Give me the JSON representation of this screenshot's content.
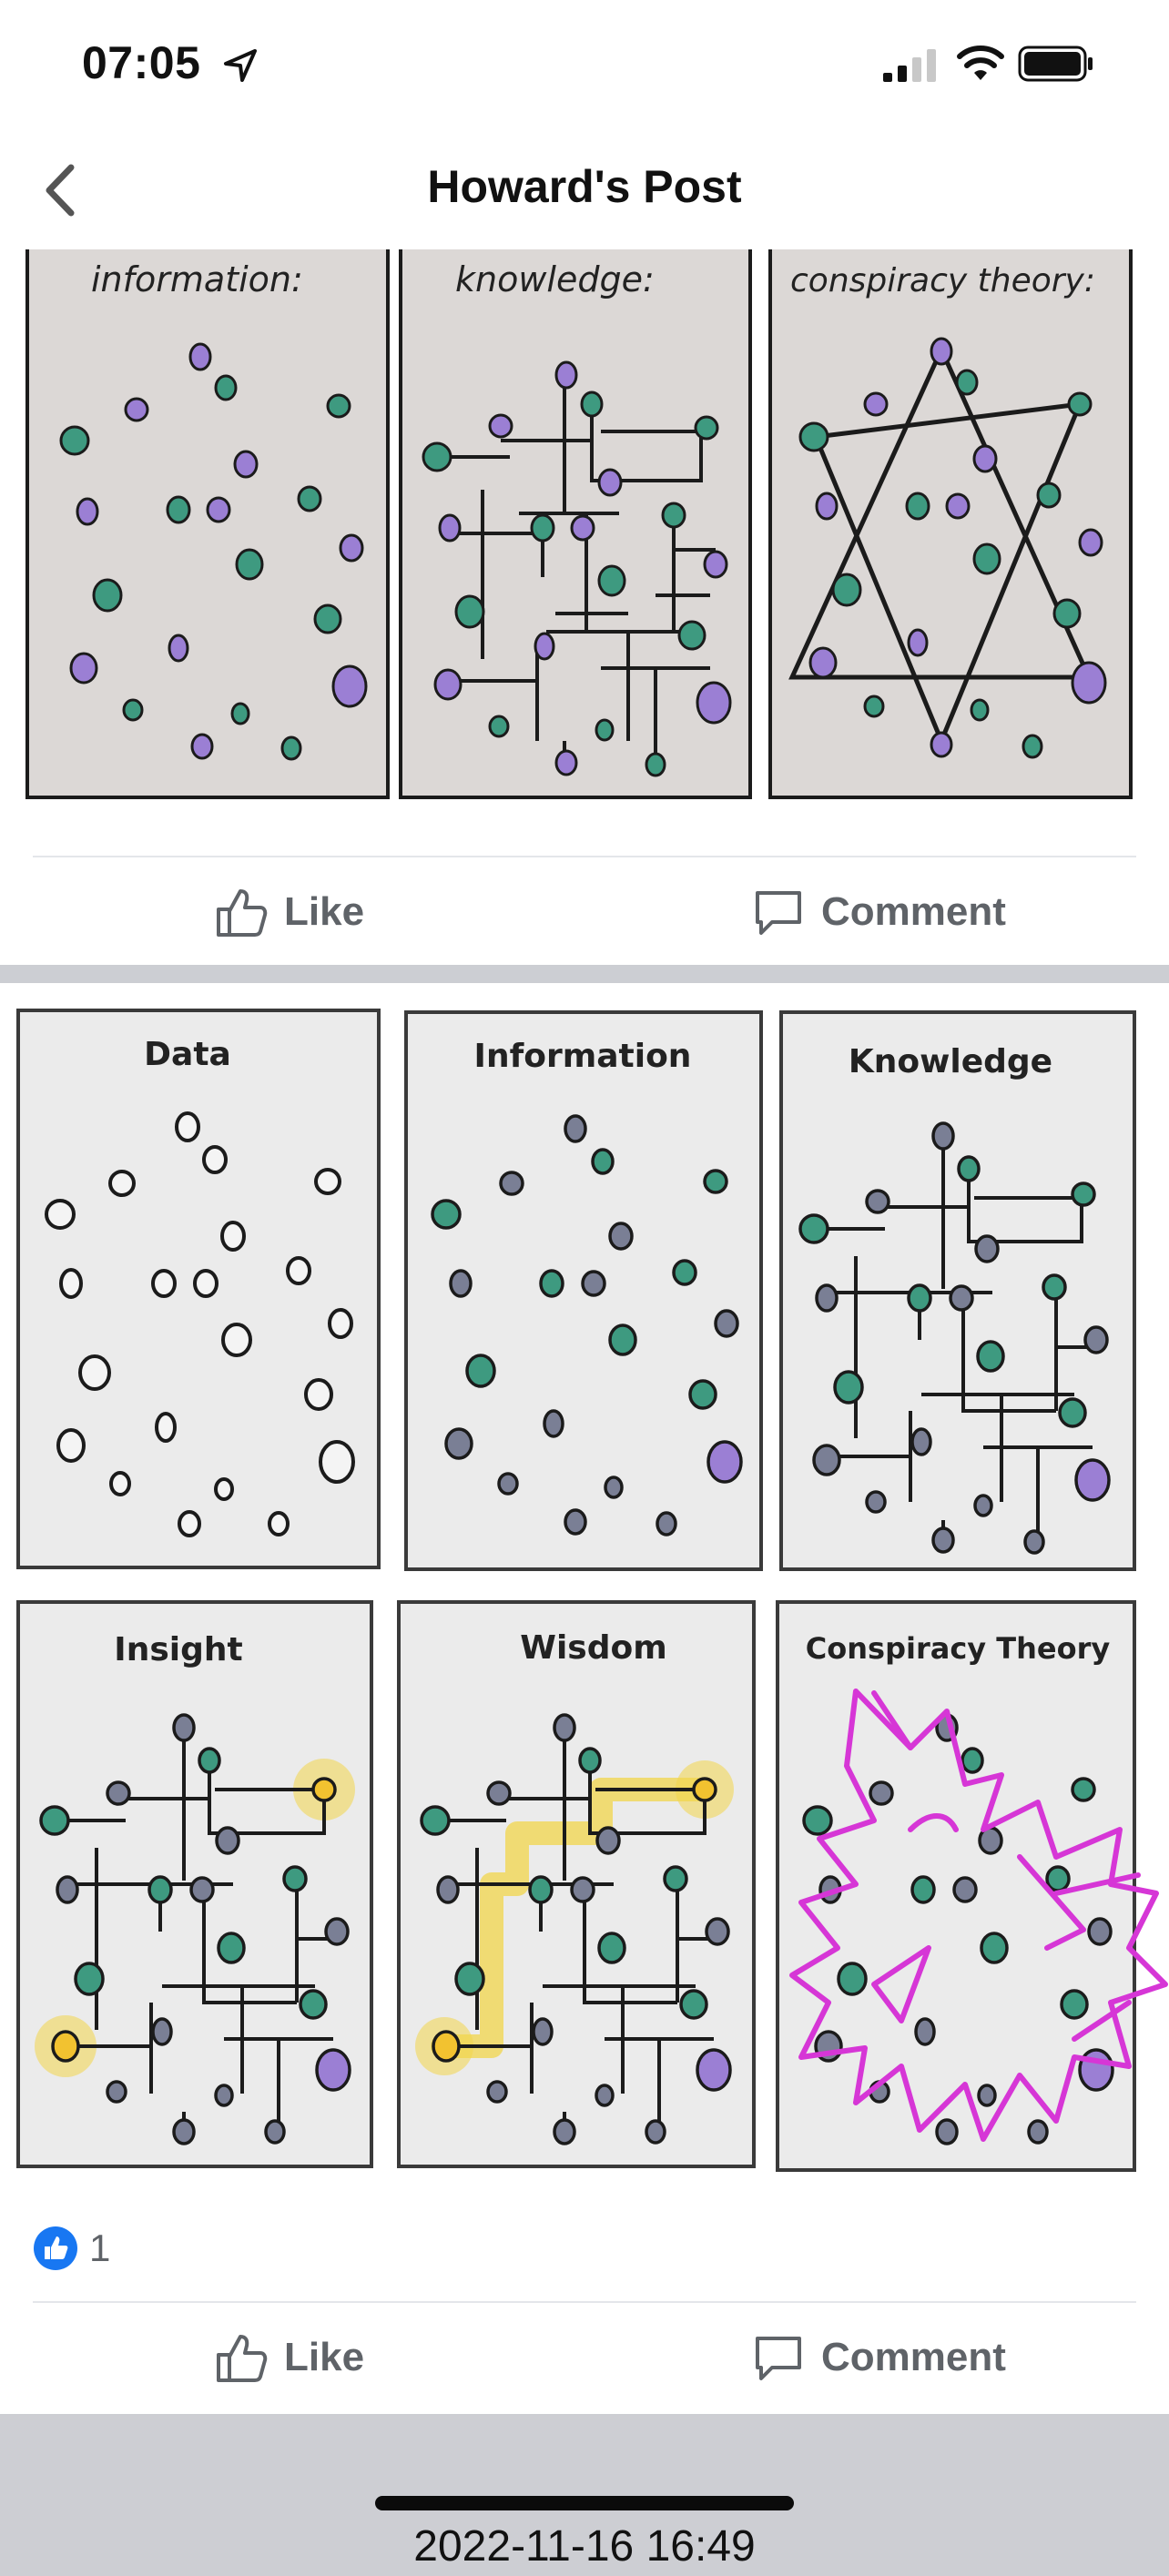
{
  "status_bar": {
    "time": "07:05",
    "icons": [
      "location-arrow-icon",
      "signal-icon",
      "wifi-icon",
      "battery-icon"
    ]
  },
  "nav": {
    "title": "Howard's Post",
    "back_icon": "chevron-left-icon"
  },
  "post_image_1": {
    "panel_labels": [
      "information:",
      "knowledge:",
      "conspiracy theory:"
    ]
  },
  "post_image_2": {
    "panel_labels": [
      "Data",
      "Information",
      "Knowledge",
      "Insight",
      "Wisdom",
      "Conspiracy Theory"
    ]
  },
  "actions_1": {
    "like_label": "Like",
    "comment_label": "Comment"
  },
  "reactions": {
    "count": "1",
    "icon": "like-reaction-icon"
  },
  "actions_2": {
    "like_label": "Like",
    "comment_label": "Comment"
  },
  "footer": {
    "timestamp": "2022-11-16 16:49"
  },
  "colors": {
    "teal_dot": "#3e9a80",
    "purple_dot": "#9b7fd4",
    "panel_bg": "#dedbd9",
    "highlight": "#f2d64b",
    "magenta": "#d636d6",
    "fb_blue": "#1877f2"
  }
}
